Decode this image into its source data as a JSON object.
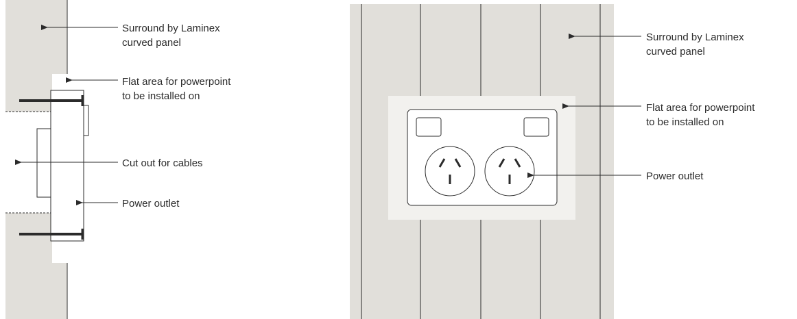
{
  "colors": {
    "panel": "#e1dfda",
    "flat_area": "#f2f1ee",
    "line": "#2b2b2b",
    "background": "#ffffff"
  },
  "side_view": {
    "labels": {
      "surround": [
        "Surround by Laminex",
        "curved panel"
      ],
      "flat_area": [
        "Flat area for powerpoint",
        "to be installed on"
      ],
      "cut_out": [
        "Cut out for cables"
      ],
      "power_outlet": [
        "Power outlet"
      ]
    }
  },
  "front_view": {
    "labels": {
      "surround": [
        "Surround by Laminex",
        "curved panel"
      ],
      "flat_area": [
        "Flat area for powerpoint",
        "to be installed on"
      ],
      "power_outlet": [
        "Power outlet"
      ]
    }
  }
}
